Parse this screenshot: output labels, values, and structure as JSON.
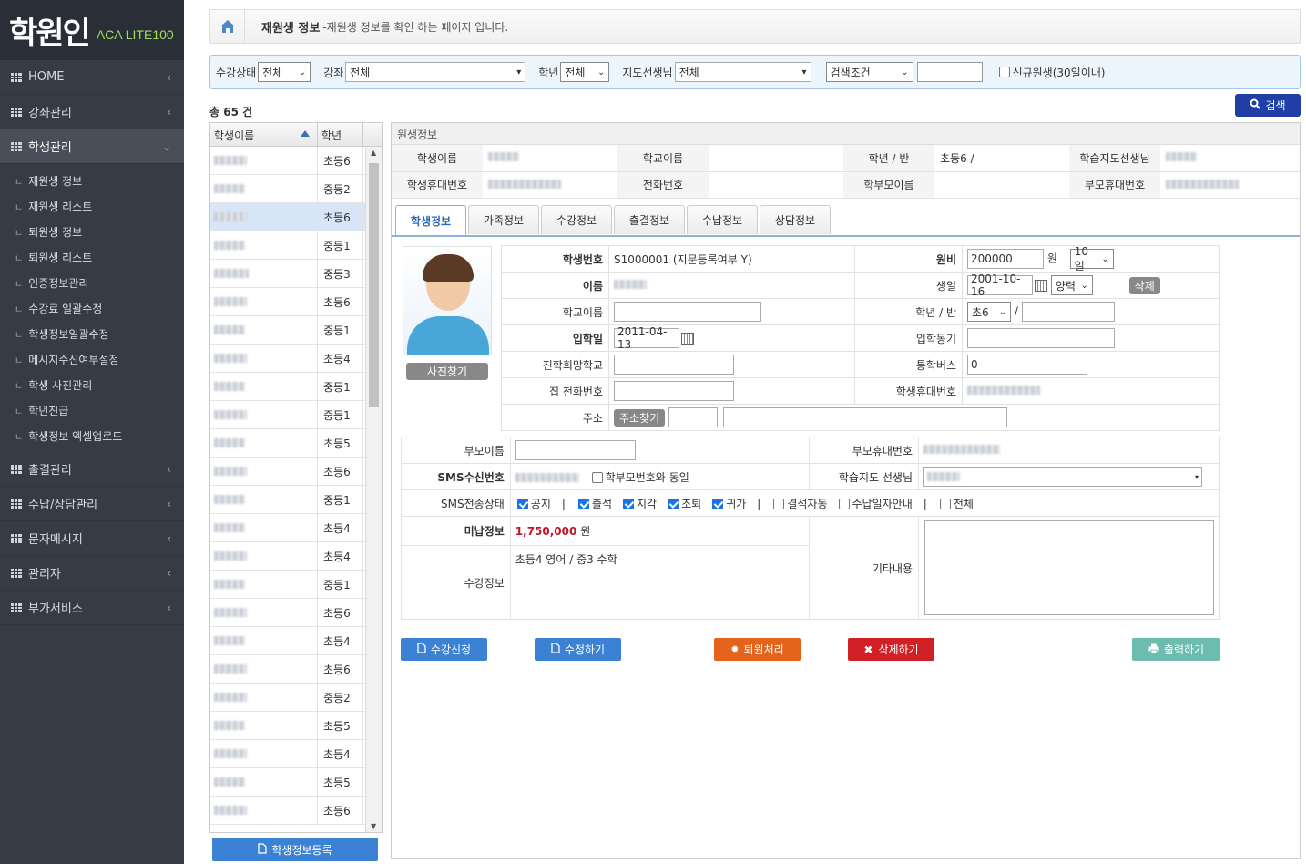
{
  "logo": {
    "main": "학원인",
    "sub": "ACA LITE100"
  },
  "sidebar": {
    "items": [
      {
        "label": "HOME"
      },
      {
        "label": "강좌관리"
      },
      {
        "label": "학생관리"
      },
      {
        "label": "출결관리"
      },
      {
        "label": "수납/상담관리"
      },
      {
        "label": "문자메시지"
      },
      {
        "label": "관리자"
      },
      {
        "label": "부가서비스"
      }
    ],
    "sub_items": [
      "재원생 정보",
      "재원생 리스트",
      "퇴원생 정보",
      "퇴원생 리스트",
      "인증정보관리",
      "수강료 일괄수정",
      "학생정보일괄수정",
      "메시지수신여부설정",
      "학생 사진관리",
      "학년진급",
      "학생정보 엑셀업로드"
    ],
    "chevron_left": "‹",
    "chevron_down": "⌄",
    "sub_mark": "ㄴ"
  },
  "breadcrumb": {
    "title": "재원생 정보",
    "desc": "-재원생 정보를 확인 하는 페이지 입니다."
  },
  "filter": {
    "status_label": "수강상태",
    "status_value": "전체",
    "course_label": "강좌",
    "course_value": "전체",
    "grade_label": "학년",
    "grade_value": "전체",
    "teacher_label": "지도선생님",
    "teacher_value": "전체",
    "cond_value": "검색조건",
    "new_label": "신규원생(30일이내)"
  },
  "search_button": "검색",
  "count_text": "총 65 건",
  "list": {
    "header_name": "학생이름",
    "header_grade": "학년",
    "rows": [
      "초등6",
      "중등2",
      "초등6",
      "중등1",
      "중등3",
      "초등6",
      "중등1",
      "초등4",
      "중등1",
      "중등1",
      "초등5",
      "초등6",
      "중등1",
      "초등4",
      "초등4",
      "중등1",
      "초등6",
      "초등4",
      "초등6",
      "중등2",
      "초등5",
      "초등4",
      "초등5",
      "초등6"
    ],
    "register_button": "학생정보등록"
  },
  "student_info": {
    "panel_title": "원생정보",
    "labels": {
      "name": "학생이름",
      "school": "학교이름",
      "grade_class": "학년 / 반",
      "teacher": "학습지도선생님",
      "phone": "학생휴대번호",
      "tel": "전화번호",
      "parent": "학부모이름",
      "parent_phone": "부모휴대번호"
    },
    "grade_value": "초등6 /"
  },
  "tabs": [
    "학생정보",
    "가족정보",
    "수강정보",
    "출결정보",
    "수납정보",
    "상담정보"
  ],
  "form": {
    "photo_button": "사진찾기",
    "student_no_label": "학생번호",
    "student_no_value": "S1000001 (지문등록여부 Y)",
    "fee_label": "원비",
    "fee_value": "200000",
    "fee_unit": "원",
    "fee_day": "10일",
    "name_label": "이름",
    "birth_label": "생일",
    "birth_value": "2001-10-16",
    "calendar_type": "양력",
    "delete_small": "삭제",
    "school_label": "학교이름",
    "grade_label": "학년 / 반",
    "grade_value": "초6",
    "grade_sep": "/",
    "entry_label": "입학일",
    "entry_value": "2011-04-13",
    "motive_label": "입학동기",
    "hope_label": "진학희망학교",
    "bus_label": "통학버스",
    "bus_value": "0",
    "home_tel_label": "집 전화번호",
    "mobile_label": "학생휴대번호",
    "address_label": "주소",
    "address_button": "주소찾기",
    "parent_name_label": "부모이름",
    "parent_phone_label": "부모휴대번호",
    "sms_no_label": "SMS수신번호",
    "same_parent_label": "학부모번호와 동일",
    "teacher_label": "학습지도 선생님",
    "sms_status_label": "SMS전송상태",
    "sms_opts": [
      {
        "label": "공지",
        "on": true
      },
      {
        "label": "출석",
        "on": true
      },
      {
        "label": "지각",
        "on": true
      },
      {
        "label": "조퇴",
        "on": true
      },
      {
        "label": "귀가",
        "on": true
      },
      {
        "label": "결석자동",
        "on": false
      },
      {
        "label": "수납일자안내",
        "on": false
      },
      {
        "label": "전체",
        "on": false
      }
    ],
    "sms_sep": "|",
    "unpaid_label": "미납정보",
    "unpaid_value": "1,750,000",
    "unpaid_unit": "원",
    "memo_label": "기타내용",
    "course_label": "수강정보",
    "course_value": "초등4 영어 / 중3 수학"
  },
  "actions": {
    "apply": "수강신청",
    "edit": "수정하기",
    "withdraw": "퇴원처리",
    "delete": "삭제하기",
    "print": "출력하기"
  },
  "colors": {
    "sidebar_bg": "#363b45",
    "search_btn": "#1f3fa6",
    "apply_btn": "#3c82d4",
    "withdraw_btn": "#e3631c",
    "delete_btn": "#d11f26",
    "print_btn": "#6cbcb0",
    "unpaid": "#c0162b"
  }
}
